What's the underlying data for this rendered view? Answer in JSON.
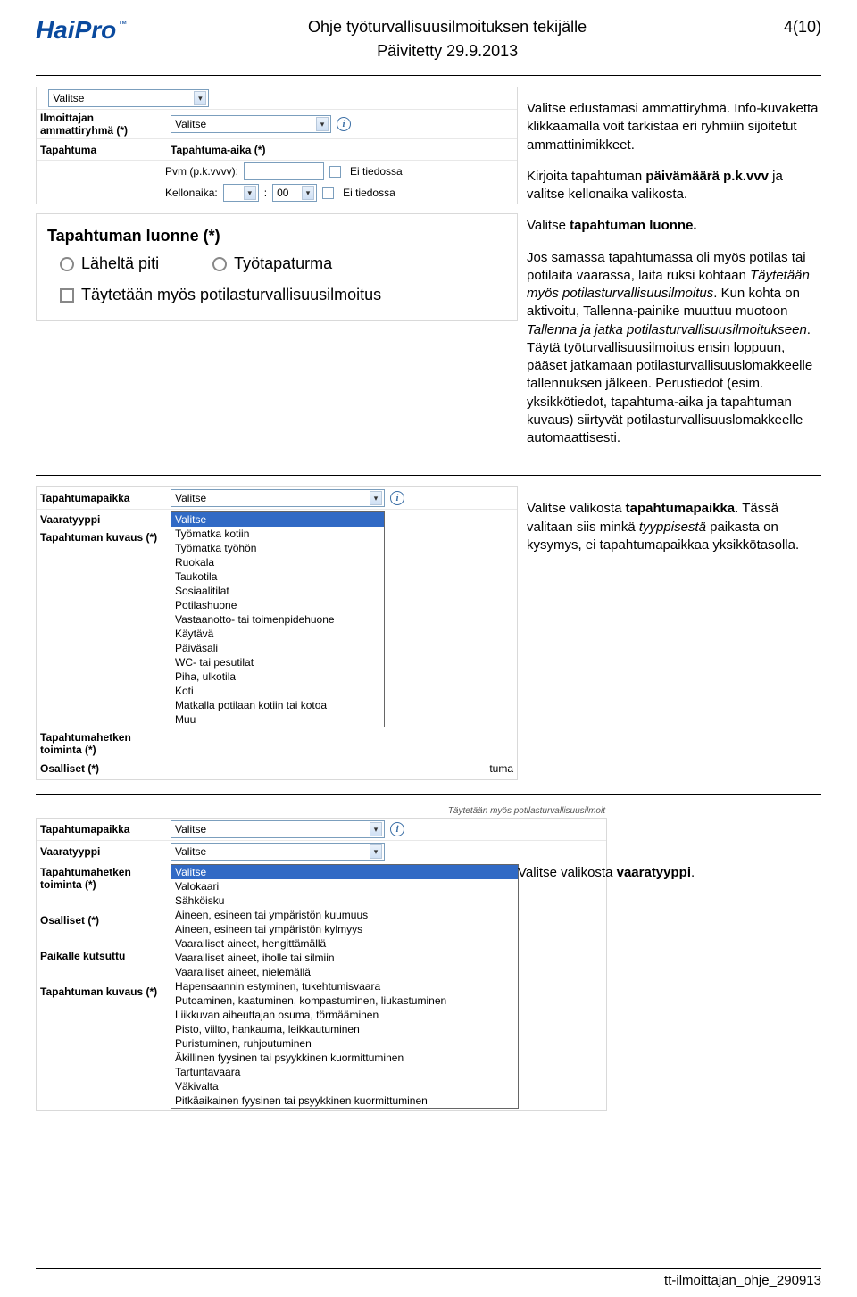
{
  "header": {
    "logo": "HaiPro",
    "title": "Ohje työturvallisuusilmoituksen tekijälle",
    "updated": "Päivitetty 29.9.2013",
    "page": "4(10)"
  },
  "panel1": {
    "top_valitse": "Valitse",
    "rows": {
      "ilmoittajan": "Ilmoittajan ammattiryhmä (*)",
      "tapahtuma": "Tapahtuma",
      "tapahtuma_aika": "Tapahtuma-aika (*)",
      "pvm": "Pvm (p.k.vvvv):",
      "kellonaika": "Kellonaika:",
      "ei_tiedossa": "Ei tiedossa",
      "valitse": "Valitse",
      "nn": "00"
    }
  },
  "luonne": {
    "title": "Tapahtuman luonne (*)",
    "opt1": "Läheltä piti",
    "opt2": "Työtapaturma",
    "check": "Täytetään myös potilasturvallisuusilmoitus"
  },
  "instr1": {
    "p1a": "Valitse edustamasi ammattiryhmä. Info-kuvaketta klikkaamalla voit tarkistaa eri ryhmiin sijoitetut ammattinimikkeet.",
    "p1b_pre": "Kirjoita tapahtuman ",
    "p1b_bold": "päivämäärä p.k.vvv",
    "p1b_post": " ja valitse kellonaika valikosta.",
    "p1c_pre": "Valitse ",
    "p1c_bold": "tapahtuman luonne.",
    "p1d": "Jos samassa tapahtumassa oli myös potilas tai potilaita vaarassa, laita ruksi kohtaan  ",
    "p1d_i1": "Täytetään myös potilasturvallisuusilmoitus",
    "p1d2": ". Kun kohta on aktivoitu, Tallenna-painike muuttuu muotoon ",
    "p1d_i2": "Tallenna ja jatka potilasturvallisuusilmoitukseen",
    "p1d3": ". Täytä työturvallisuusilmoitus ensin loppuun, pääset jatkamaan potilasturvallisuuslomakkeelle tallennuksen jälkeen. Perustiedot  (esim.  yksikkötiedot, tapahtuma-aika ja tapahtuman kuvaus) siirtyvät potilasturvallisuuslomakkeelle automaattisesti."
  },
  "panel2": {
    "labels": {
      "paikka": "Tapahtumapaikka",
      "vaara": "Vaaratyyppi",
      "kuvaus": "Tapahtuman kuvaus (*)",
      "hetki": "Tapahtumahetken toiminta (*)",
      "osalliset": "Osalliset (*)"
    },
    "valitse": "Valitse",
    "options": [
      "Valitse",
      "Työmatka kotiin",
      "Työmatka työhön",
      "Ruokala",
      "Taukotila",
      "Sosiaalitilat",
      "Potilashuone",
      "Vastaanotto- tai toimenpidehuone",
      "Käytävä",
      "Päiväsali",
      "WC- tai pesutilat",
      "Piha, ulkotila",
      "Koti",
      "Matkalla potilaan kotiin tai kotoa",
      "Muu"
    ],
    "trunc_end": "tuma"
  },
  "instr2_pre": "Valitse valikosta ",
  "instr2_b": "tapahtumapaikka",
  "instr2_post": ". Tässä valitaan siis minkä ",
  "instr2_i": "tyyppisestä",
  "instr2_post2": " paikasta on kysymys, ei tapahtumapaikkaa yksikkötasolla.",
  "panel3": {
    "overflow": "Täytetään myös potilasturvallisuusilmoit",
    "labels": {
      "paikka": "Tapahtumapaikka",
      "vaara": "Vaaratyyppi",
      "hetki": "Tapahtumahetken toiminta (*)",
      "osalliset": "Osalliset (*)",
      "kutsuttu": "Paikalle kutsuttu",
      "kuvaus": "Tapahtuman kuvaus (*)"
    },
    "valitse": "Valitse",
    "options": [
      "Valitse",
      "Valokaari",
      "Sähköisku",
      "Aineen, esineen tai ympäristön kuumuus",
      "Aineen, esineen tai ympäristön kylmyys",
      "Vaaralliset aineet, hengittämällä",
      "Vaaralliset aineet, iholle tai silmiin",
      "Vaaralliset aineet, nielemällä",
      "Hapensaannin estyminen, tukehtumisvaara",
      "Putoaminen, kaatuminen, kompastuminen, liukastuminen",
      "Liikkuvan aiheuttajan osuma, törmääminen",
      "Pisto, viilto, hankauma, leikkautuminen",
      "Puristuminen, ruhjoutuminen",
      "Äkillinen fyysinen tai psyykkinen kuormittuminen",
      "Tartuntavaara",
      "Väkivalta",
      "Pitkäaikainen fyysinen tai psyykkinen kuormittuminen"
    ]
  },
  "instr3_pre": "Valitse valikosta ",
  "instr3_b": "vaaratyyppi",
  "instr3_post": ".",
  "footer": "tt-ilmoittajan_ohje_290913"
}
